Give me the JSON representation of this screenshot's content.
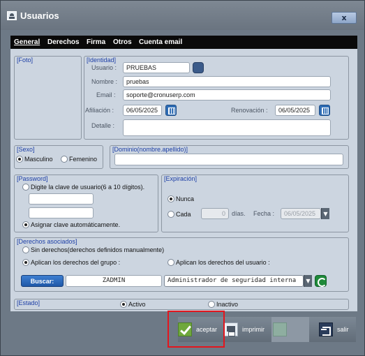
{
  "window": {
    "title": "Usuarios",
    "close_label": "x"
  },
  "tabs": [
    "General",
    "Derechos",
    "Firma",
    "Otros",
    "Cuenta email"
  ],
  "foto": {
    "label": "[Foto]"
  },
  "identidad": {
    "label": "[Identidad]",
    "usuario_label": "Usuario :",
    "usuario_value": "PRUEBAS",
    "nombre_label": "Nombre :",
    "nombre_value": "pruebas",
    "email_label": "Email :",
    "email_value": "soporte@cronuserp.com",
    "afiliacion_label": "Afiliación :",
    "afiliacion_value": "06/05/2025",
    "renovacion_label": "Renovación :",
    "renovacion_value": "06/05/2025",
    "detalle_label": "Detalle :",
    "detalle_value": ""
  },
  "sexo": {
    "label": "[Sexo]",
    "masculino": "Masculino",
    "femenino": "Femenino",
    "selected": "Masculino"
  },
  "dominio": {
    "label": "[Dominio(nombre.apellido)]",
    "value": ""
  },
  "password": {
    "label": "[Password]",
    "option_manual": "Digite la clave de usuario(6 a 10 dígitos).",
    "option_auto": "Asignar clave automáticamente.",
    "selected": "auto"
  },
  "expiracion": {
    "label": "[Expiración]",
    "nunca": "Nunca",
    "cada": "Cada",
    "cada_value": "0",
    "dias_label": "días.",
    "fecha_label": "Fecha :",
    "fecha_value": "06/05/2025",
    "selected": "nunca"
  },
  "derechos": {
    "label": "[Derechos asociados]",
    "sin": "Sin derechos(derechos definidos manualmente)",
    "grupo": "Aplican los derechos del grupo :",
    "usuario": "Aplican los derechos del usuario :",
    "selected": "grupo",
    "buscar_label": "Buscar:",
    "group_code": "ZADMIN",
    "group_name": "Administrador de seguridad interna"
  },
  "estado": {
    "label": "[Estado]",
    "activo": "Activo",
    "inactivo": "Inactivo",
    "selected": "activo"
  },
  "actions": {
    "aceptar": "aceptar",
    "imprimir": "imprimir",
    "disabled": "",
    "salir": "salir"
  },
  "colors": {
    "accent": "#1d3fa6",
    "highlight": "#e4151d",
    "panel": "#ccd5e0"
  }
}
